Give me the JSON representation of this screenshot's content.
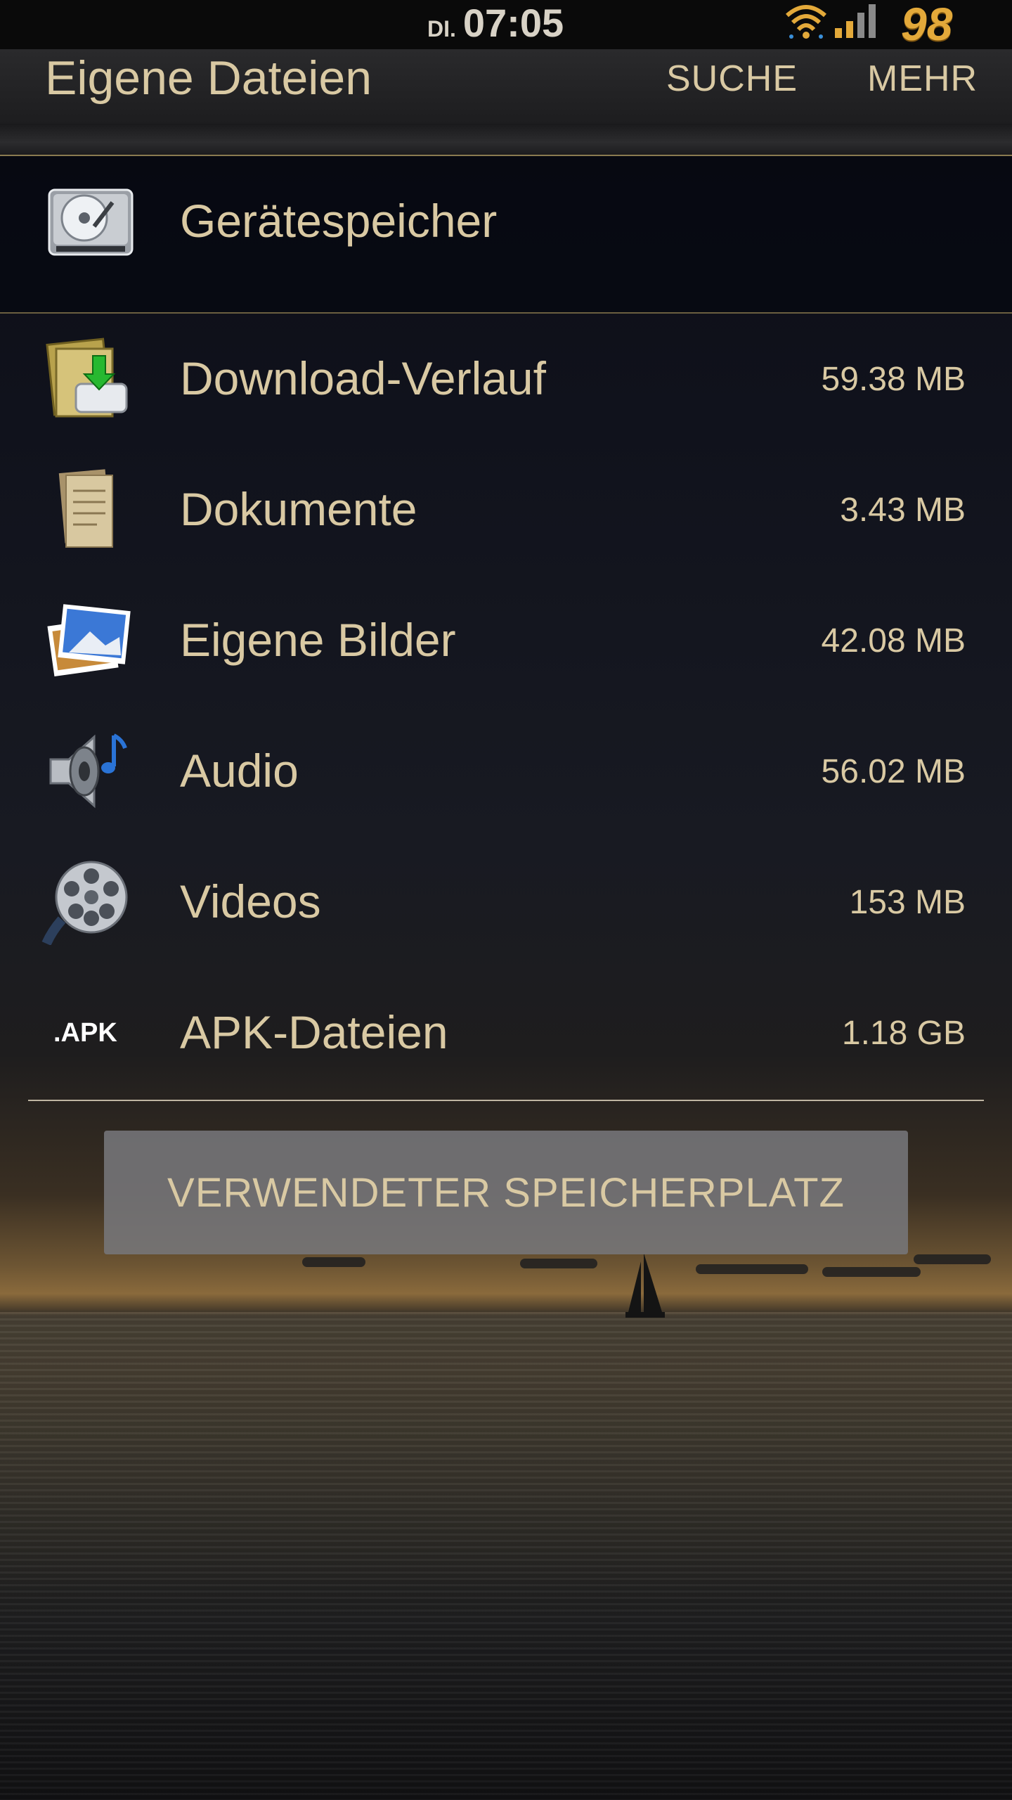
{
  "status_bar": {
    "day": "DI.",
    "time": "07:05",
    "battery": "98",
    "icons": [
      "wifi-icon",
      "signal-icon"
    ]
  },
  "action_bar": {
    "title": "Eigene Dateien",
    "search_label": "SUCHE",
    "more_label": "MEHR"
  },
  "device_storage": {
    "icon": "hard-drive-icon",
    "label": "Gerätespeicher"
  },
  "categories": [
    {
      "icon": "download-folder-icon",
      "label": "Download-Verlauf",
      "size": "59.38 MB"
    },
    {
      "icon": "document-icon",
      "label": "Dokumente",
      "size": "3.43 MB"
    },
    {
      "icon": "photos-icon",
      "label": "Eigene Bilder",
      "size": "42.08 MB"
    },
    {
      "icon": "speaker-music-icon",
      "label": "Audio",
      "size": "56.02 MB"
    },
    {
      "icon": "film-reel-icon",
      "label": "Videos",
      "size": "153 MB"
    },
    {
      "icon": "apk-icon",
      "label": "APK-Dateien",
      "size": "1.18 GB",
      "icon_text": ".APK"
    }
  ],
  "used_storage_button": "VERWENDETER SPEICHERPLATZ",
  "colors": {
    "text": "#d9c9a3",
    "battery": "#e3a93a",
    "background": "#0c0e16"
  }
}
